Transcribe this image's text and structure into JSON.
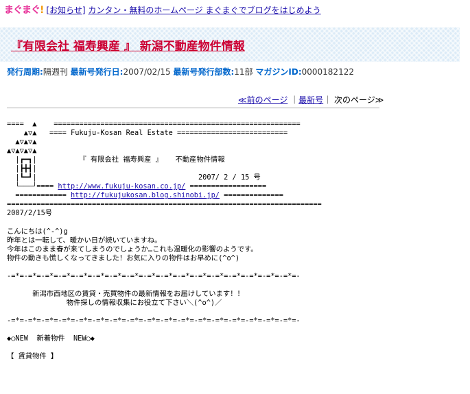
{
  "header": {
    "logo_text": "まぐまぐ",
    "logo_bang": "!",
    "notice_tag": "[お知らせ]",
    "notice_link": "カンタン・無料のホームページ まぐまぐでブログをはじめよう"
  },
  "magazine": {
    "title": "『有限会社 福寿興産 』 新潟不動産物件情報",
    "meta": {
      "cycle_label": "発行周期:",
      "cycle_value": "隔週刊",
      "latest_date_label": "最新号発行日:",
      "latest_date_value": "2007/02/15",
      "copies_label": "最新号発行部数:",
      "copies_value": "11部",
      "id_label": "マガジンID:",
      "id_value": "0000182122"
    }
  },
  "pager": {
    "prev": "≪前のページ",
    "sep1": "｜",
    "latest": "最新号",
    "sep2": "｜",
    "next": "次のページ≫"
  },
  "issue": {
    "l1": "====  ▲    ==========================================================",
    "l2": "    ▲▽▲   ==== Fukuju-Kosan Real Estate ==========================",
    "l3": "  ▲▽▲▽▲",
    "l4": "▲▽▲▽▲▽▲",
    "l5": "  |┏━┓|          『 有限会社 福寿興産 』   不動産物件情報",
    "l6": "  |┣╋┫|",
    "l7": "  |┗━┛|                                      2007/ 2 / 15 号",
    "l8a": "  └───┘==== ",
    "url1": "http://www.fukuju-kosan.co.jp/",
    "l8b": " ==================",
    "l9a": "  ============ ",
    "url2": "http://fukujukosan.blog.shinobi.jp/",
    "l9b": " ==============",
    "l10": "==========================================================================",
    "date": "2007/2/15号",
    "blank1": "",
    "g1": "こんにちは(^-^)g",
    "g2": "昨年とは一転して、暖かい日が続いていますね。",
    "g3": "今年はこのまま春が来てしまうのでしょうか…これも温暖化の影響のようです。",
    "g4": "物件の動きも慌しくなってきました！お気に入りの物件はお早めに(^o^)",
    "blank2": "",
    "div1": "-=*=-=*=-=*=-=*=-=*=-=*=-=*=-=*=-=*=-=*=-=*=-=*=-=*=-=*=-=*=-=*=-=*=-",
    "blank3": "",
    "msg1": "      新潟市西地区の賃貸・売買物件の最新情報をお届けしています！！",
    "msg2": "              物件探しの情報収集にお役立て下さい＼(^o^)／",
    "blank4": "",
    "div2": "-=*=-=*=-=*=-=*=-=*=-=*=-=*=-=*=-=*=-=*=-=*=-=*=-=*=-=*=-=*=-=*=-=*=-",
    "blank5": "",
    "new_header": "◆○NEW  新着物件  NEW○◆",
    "blank6": "",
    "rental": "【 賃貸物件 】"
  }
}
